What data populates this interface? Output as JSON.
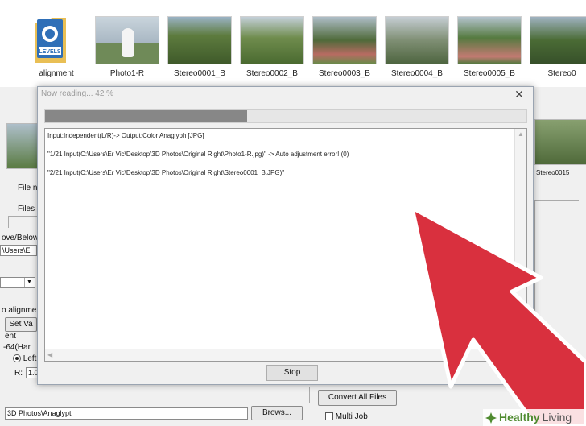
{
  "thumbnails": [
    {
      "caption": "alignment",
      "kind": "folder",
      "folder_label": "LEVELS"
    },
    {
      "caption": "Photo1-R",
      "kind": "photo",
      "color": "#a9b7c3"
    },
    {
      "caption": "Stereo0001_B",
      "kind": "photo",
      "color": "#5d7b3e"
    },
    {
      "caption": "Stereo0002_B",
      "kind": "photo",
      "color": "#6f8c4d"
    },
    {
      "caption": "Stereo0003_B",
      "kind": "photo",
      "color": "#4f6a3a"
    },
    {
      "caption": "Stereo0004_B",
      "kind": "photo",
      "color": "#7f8f74"
    },
    {
      "caption": "Stereo0005_B",
      "kind": "photo",
      "color": "#557a40"
    },
    {
      "caption": "Stereo0",
      "kind": "photo",
      "color": "#4a6b35"
    }
  ],
  "background": {
    "labels": {
      "file_name": "File na",
      "files": "Files o",
      "above_below": "ove/Below",
      "path": "\\Users\\E",
      "auto_align": "o alignme",
      "set_val": "Set Va",
      "ent": "ent",
      "range": "-64(Har",
      "left": "Left",
      "r": "R:",
      "r_value": "1.0",
      "stereo_label": "Stereo0015"
    },
    "output_path": "3D Photos\\Anaglypt",
    "browse_label": "Brows...",
    "convert_all_label": "Convert All Files",
    "multi_job_label": "Multi Job"
  },
  "dialog": {
    "title": "Now reading... 42 %",
    "progress": 0.42,
    "log_lines": [
      "Input:Independent(L/R)-> Output:Color Anaglyph [JPG]",
      "\"1/21 Input(C:\\Users\\Er Vic\\Desktop\\3D Photos\\Original Right\\Photo1-R.jpg)\" -> Auto adjustment error! (0)",
      "\"2/21 Input(C:\\Users\\Er Vic\\Desktop\\3D Photos\\Original Right\\Stereo0001_B.JPG)\""
    ],
    "stop_label": "Stop"
  },
  "overlay": {
    "arrow_color": "#d9303e",
    "arrow_outline": "#ffffff"
  },
  "watermark": {
    "brand_a": "Healthy",
    "brand_b": "Living"
  }
}
